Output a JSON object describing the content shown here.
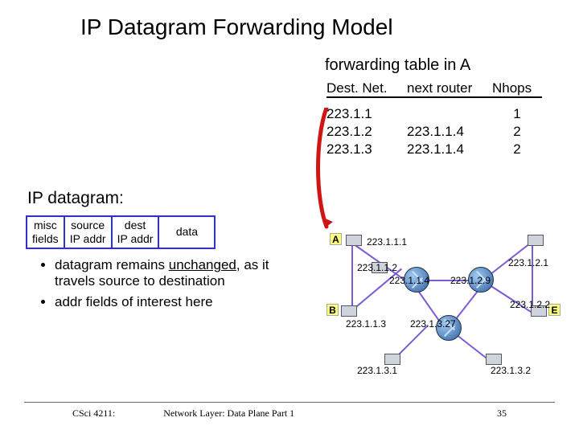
{
  "title": "IP Datagram Forwarding Model",
  "subtitle": "forwarding table in A",
  "subheading": "IP datagram:",
  "table": {
    "headers": {
      "c1": "Dest. Net.",
      "c2": "next router",
      "c3": "Nhops"
    },
    "rows": [
      {
        "dest": "223.1.1",
        "next": "",
        "hops": "1"
      },
      {
        "dest": "223.1.2",
        "next": "223.1.1.4",
        "hops": "2"
      },
      {
        "dest": "223.1.3",
        "next": "223.1.1.4",
        "hops": "2"
      }
    ]
  },
  "datagram": {
    "c1a": "misc",
    "c1b": "fields",
    "c2a": "source",
    "c2b": "IP addr",
    "c3a": "dest",
    "c3b": "IP addr",
    "c4": "data"
  },
  "bullets": {
    "b1": "datagram remains unchanged, as it travels source to destination",
    "b2": "addr fields of interest here"
  },
  "network": {
    "hosts": {
      "A": "A",
      "B": "B",
      "E": "E"
    },
    "ips": {
      "a": "223.1.1.1",
      "h12": "223.1.1.2",
      "h13": "223.1.1.3",
      "r114": "223.1.1.4",
      "r129": "223.1.2.9",
      "h21": "223.1.2.1",
      "h22": "223.1.2.2",
      "r1327": "223.1.3.27",
      "h31": "223.1.3.1",
      "h32": "223.1.3.2"
    }
  },
  "footer": {
    "left": "CSci 4211:",
    "mid": "Network Layer: Data Plane Part 1",
    "page": "35"
  }
}
